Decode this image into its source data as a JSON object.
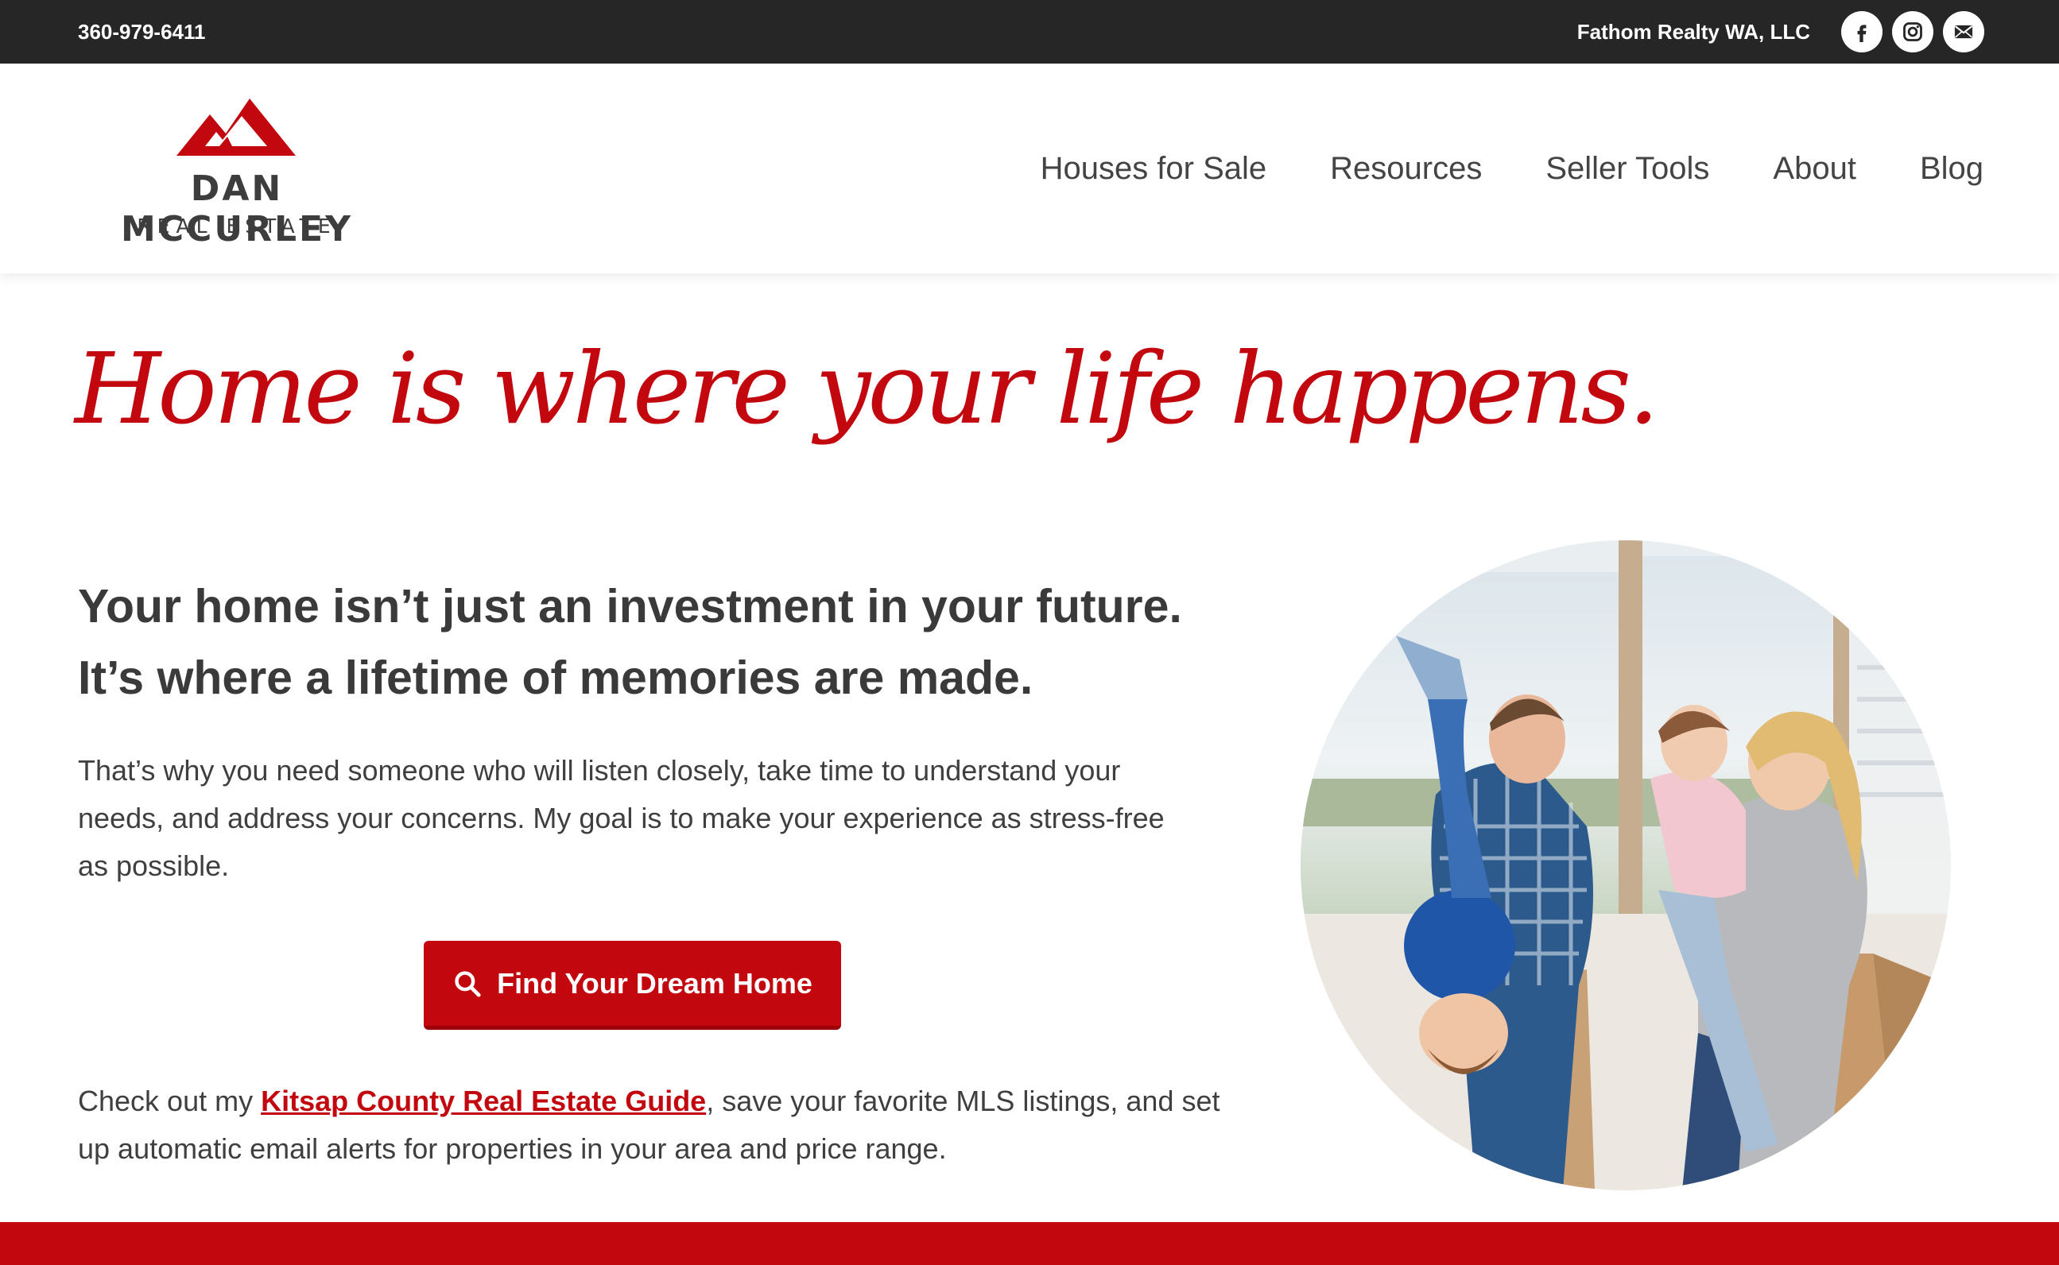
{
  "topbar": {
    "phone": "360-979-6411",
    "brokerage": "Fathom Realty WA, LLC",
    "social_icons": [
      "facebook-icon",
      "instagram-icon",
      "email-icon"
    ]
  },
  "logo": {
    "name": "DAN MCCURLEY",
    "subtitle": "REAL ESTATE"
  },
  "nav": {
    "items": [
      {
        "label": "Houses for Sale"
      },
      {
        "label": "Resources"
      },
      {
        "label": "Seller Tools"
      },
      {
        "label": "About"
      },
      {
        "label": "Blog"
      }
    ]
  },
  "hero": {
    "headline": "Home is where your life happens.",
    "subheadline_line1": "Your home isn’t just an investment in your future.",
    "subheadline_line2": "It’s where a lifetime of memories are made.",
    "body": "That’s why you need someone who will listen closely, take time to understand your needs, and address your concerns. My goal is to make your experience as stress-free as possible.",
    "cta_label": "Find Your Dream Home",
    "guide_prefix": "Check out my ",
    "guide_link": "Kitsap County Real Estate Guide",
    "guide_suffix": ", save your favorite MLS listings, and set up automatic email alerts for properties in your area and price range."
  },
  "colors": {
    "brand_red": "#c2070f",
    "topbar_bg": "#262626",
    "text_dark": "#3a3a3a"
  }
}
